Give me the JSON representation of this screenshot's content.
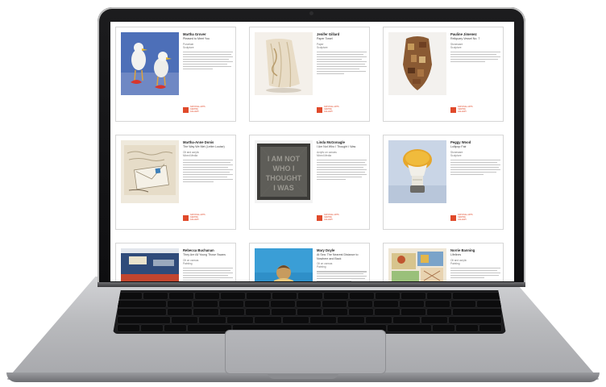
{
  "cards": [
    {
      "artist": "Martha Grover",
      "work": "Pleased to Meet You",
      "meta1": "Porcelain",
      "meta2": "Sculpture"
    },
    {
      "artist": "Jenifer Gillard",
      "work": "Paper Towel",
      "meta1": "Paper",
      "meta2": "Sculpture"
    },
    {
      "artist": "Pauline Jimenez",
      "work": "Reliquary Vessel No. 7",
      "meta1": "Stoneware",
      "meta2": "Sculpture"
    },
    {
      "artist": "Martha-Anne Donis",
      "work": "The Way We Met (Letter Louise)",
      "meta1": "Oil and acrylic",
      "meta2": "Mixed Media"
    },
    {
      "artist": "Linda McGonagle",
      "work": "I Am Not Who I Thought I Was",
      "meta1": "Acrylic on canvas",
      "meta2": "Mixed Media"
    },
    {
      "artist": "Peggy Wood",
      "work": "Lollipop Fair",
      "meta1": "Stoneware",
      "meta2": "Sculpture"
    },
    {
      "artist": "Rebecca Buchanan",
      "work": "They Are All Young Those Swans",
      "meta1": "Oil on canvas",
      "meta2": "Painting"
    },
    {
      "artist": "Mary Doyle",
      "work": "At Sea: The Nearest Distance to Nowhere and Back",
      "meta1": "Oil on canvas",
      "meta2": "Painting"
    },
    {
      "artist": "Norrie Banning",
      "work": "Lifelines",
      "meta1": "Oil and acrylic",
      "meta2": "Painting"
    }
  ],
  "badge_text": "NATIONAL ARTS CENTRE GALLERY",
  "colors": {
    "accent": "#e04a2b",
    "frame": "#1c1c1e",
    "chassis": "#c0c1c4"
  }
}
